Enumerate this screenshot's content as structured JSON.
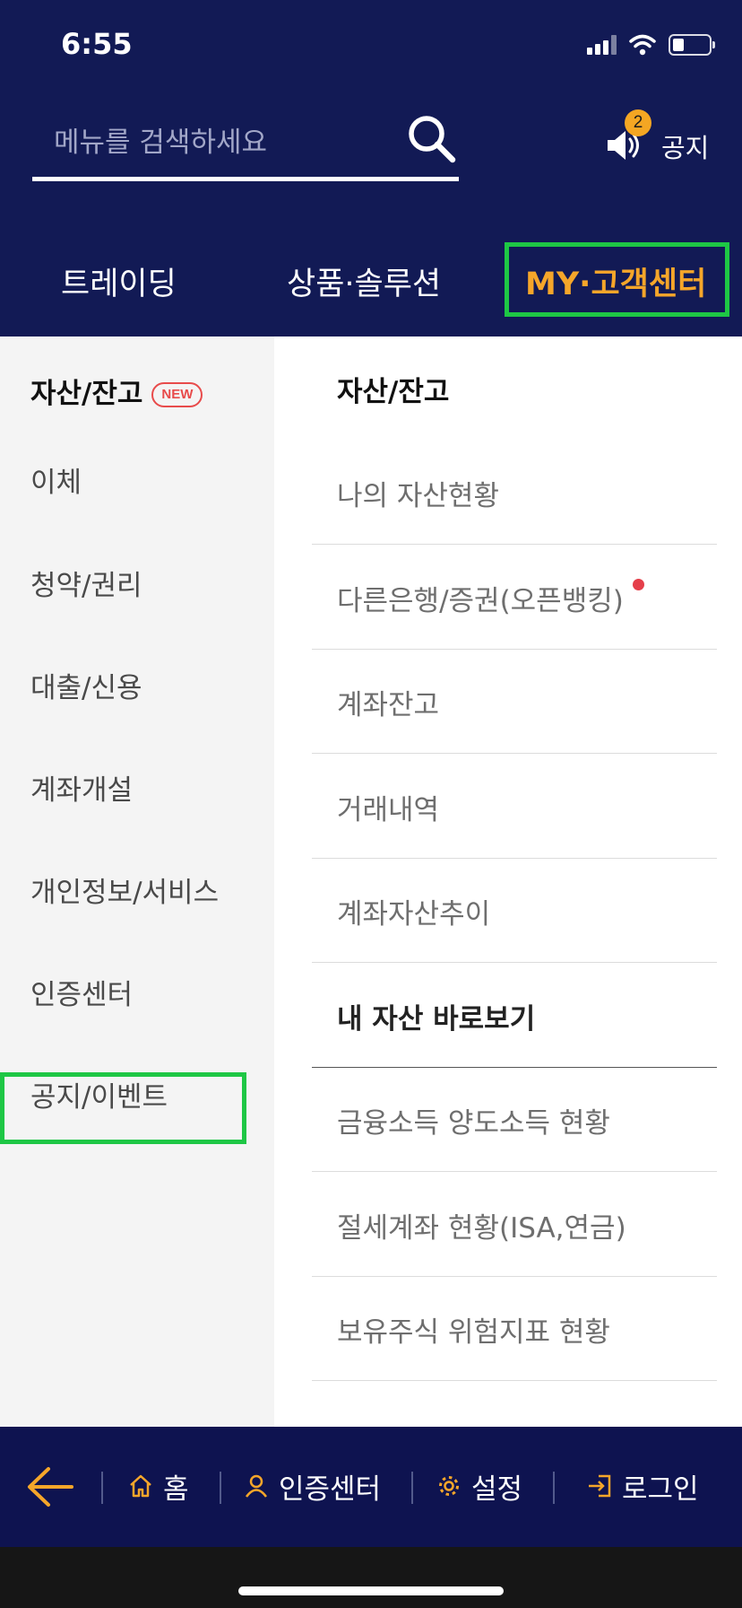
{
  "status_bar": {
    "time": "6:55"
  },
  "search": {
    "placeholder": "메뉴를 검색하세요"
  },
  "notice": {
    "count": "2",
    "label": "공지"
  },
  "tabs": [
    {
      "label": "트레이딩",
      "selected": false
    },
    {
      "label": "상품·솔루션",
      "selected": false
    },
    {
      "label": "MY·고객센터",
      "selected": true
    }
  ],
  "left_nav": {
    "new_badge": "NEW",
    "items": [
      {
        "label": "자산/잔고",
        "active": true
      },
      {
        "label": "이체"
      },
      {
        "label": "청약/권리"
      },
      {
        "label": "대출/신용"
      },
      {
        "label": "계좌개설"
      },
      {
        "label": "개인정보/서비스"
      },
      {
        "label": "인증센터"
      },
      {
        "label": "공지/이벤트"
      }
    ]
  },
  "sub_menu": {
    "section1_title": "자산/잔고",
    "section1_items": [
      {
        "label": "나의 자산현황"
      },
      {
        "label": "다른은행/증권(오픈뱅킹)",
        "has_dot": true
      },
      {
        "label": "계좌잔고"
      },
      {
        "label": "거래내역"
      },
      {
        "label": "계좌자산추이"
      }
    ],
    "section2_title": "내 자산 바로보기",
    "section2_items": [
      {
        "label": "금융소득 양도소득 현황"
      },
      {
        "label": "절세계좌 현황(ISA,연금)"
      },
      {
        "label": "보유주식 위험지표 현황"
      }
    ]
  },
  "bottom_nav": {
    "home": "홈",
    "auth": "인증센터",
    "settings": "설정",
    "login": "로그인"
  },
  "colors": {
    "header_bg": "#121a55",
    "accent": "#f5a62a",
    "highlight": "#1ec745",
    "new_badge": "#e84b4b"
  }
}
